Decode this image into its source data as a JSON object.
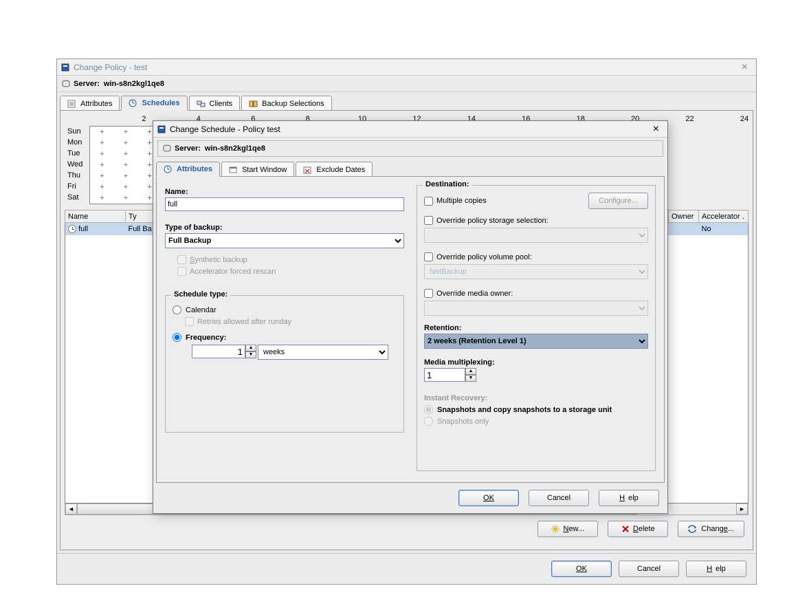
{
  "outer": {
    "title": "Change Policy - test",
    "server_label": "Server:",
    "server_name": "win-s8n2kgl1qe8",
    "tabs": [
      "Attributes",
      "Schedules",
      "Clients",
      "Backup Selections"
    ],
    "ruler": [
      "2",
      "4",
      "6",
      "8",
      "10",
      "12",
      "14",
      "16",
      "18",
      "20",
      "22",
      "24"
    ],
    "days": [
      "Sun",
      "Mon",
      "Tue",
      "Wed",
      "Thu",
      "Fri",
      "Sat"
    ],
    "table": {
      "headers": [
        "Name",
        "Ty",
        "Owner",
        "Accelerator ."
      ],
      "row": {
        "name": "full",
        "type": "Full Ba",
        "owner": "",
        "accel": "No"
      }
    },
    "buttons": {
      "new": "New...",
      "delete": "Delete",
      "change": "Change..."
    },
    "footer": {
      "ok": "OK",
      "cancel": "Cancel",
      "help": "Help"
    }
  },
  "inner": {
    "title": "Change Schedule - Policy test",
    "server_label": "Server:",
    "server_name": "win-s8n2kgl1qe8",
    "tabs": [
      "Attributes",
      "Start Window",
      "Exclude Dates"
    ],
    "name_label": "Name:",
    "name_value": "full",
    "type_label": "Type of backup:",
    "type_value": "Full Backup",
    "synthetic": "Synthetic backup",
    "accel_rescan": "Accelerator forced rescan",
    "schedule_type": "Schedule type:",
    "calendar": "Calendar",
    "retries": "Retries allowed after runday",
    "frequency": "Frequency:",
    "freq_value": "1",
    "freq_unit": "weeks",
    "destination": "Destination:",
    "multiple_copies": "Multiple copies",
    "configure": "Configure...",
    "override_storage": "Override policy storage selection:",
    "override_volume": "Override policy volume pool:",
    "volume_value": "NetBackup",
    "override_owner": "Override media owner:",
    "retention_label": "Retention:",
    "retention_value": "2 weeks (Retention Level 1)",
    "mpx_label": "Media multiplexing:",
    "mpx_value": "1",
    "instant_recovery": "Instant Recovery:",
    "ir_opt1": "Snapshots and copy snapshots to a storage unit",
    "ir_opt2": "Snapshots only",
    "footer": {
      "ok": "OK",
      "cancel": "Cancel",
      "help": "Help"
    }
  }
}
